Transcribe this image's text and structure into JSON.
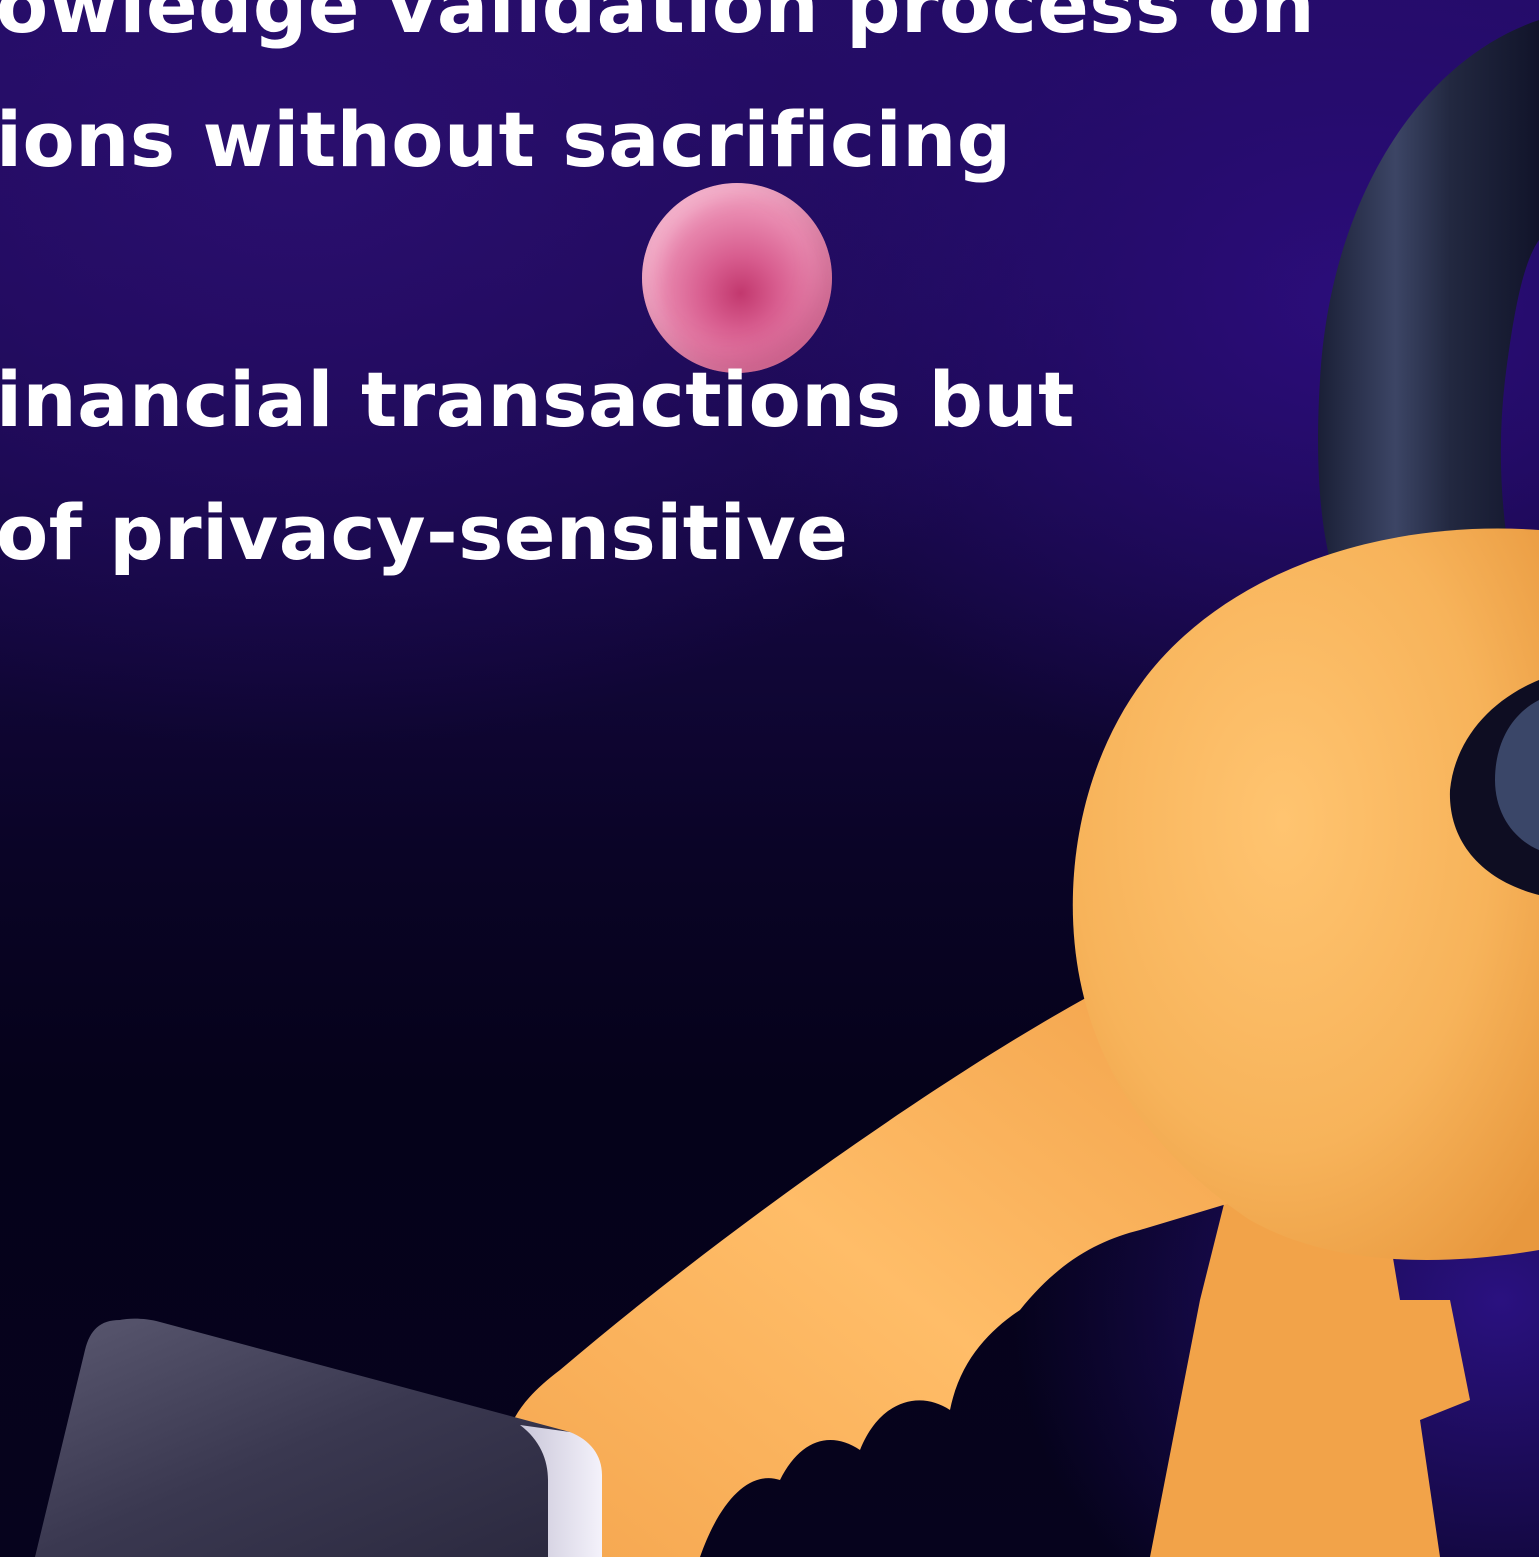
{
  "text": {
    "line1": "owledge validation process on",
    "line2": "ions without sacrificing",
    "line3": "inancial transactions but",
    "line4": "of privacy-sensitive"
  },
  "colors": {
    "text": "#ffffff",
    "background_top": "#220c63",
    "background_bottom": "#05021a",
    "key": "#f7b35a",
    "blob": "#e98ab0",
    "ring": "#2b3350",
    "block": "#3a3850"
  },
  "illustration": {
    "objects": [
      "pink-sphere",
      "key-ring",
      "golden-key",
      "grey-block"
    ]
  }
}
